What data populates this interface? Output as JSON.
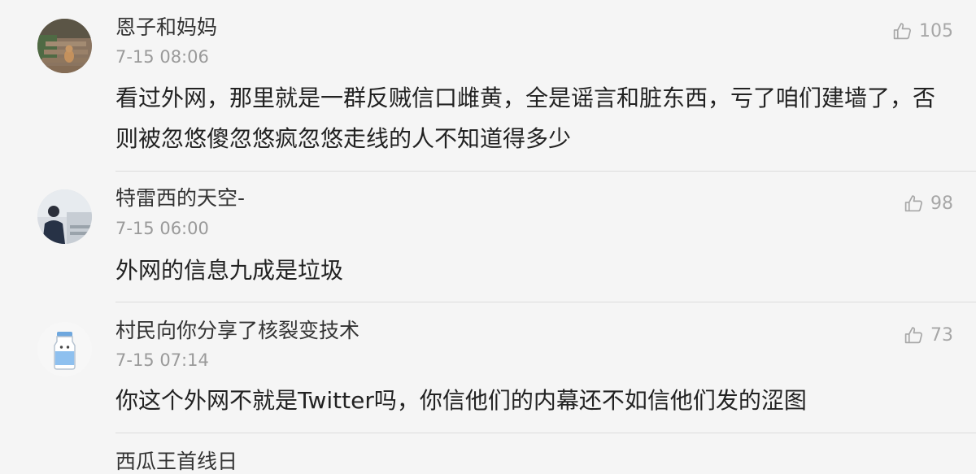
{
  "comments": [
    {
      "username": "恩子和妈妈",
      "timestamp": "7-15 08:06",
      "likes": "105",
      "text": "看过外网，那里就是一群反贼信口雌黄，全是谣言和脏东西，亏了咱们建墙了，否则被忽悠傻忽悠疯忽悠走线的人不知道得多少",
      "avatar_icon": "avatar-photo-cat-on-stairs"
    },
    {
      "username": "特雷西的天空-",
      "timestamp": "7-15 06:00",
      "likes": "98",
      "text": "外网的信息九成是垃圾",
      "avatar_icon": "avatar-photo-person-by-window"
    },
    {
      "username": "村民向你分享了核裂变技术",
      "timestamp": "7-15 07:14",
      "likes": "73",
      "text": "你这个外网不就是Twitter吗，你信他们的内幕还不如信他们发的涩图",
      "avatar_icon": "avatar-cartoon-milk-bottle"
    }
  ],
  "partial_comment": {
    "username_fragment": "西瓜王首线日"
  },
  "like_icon": "thumbs-up-icon",
  "colors": {
    "background": "#f5f5f5",
    "username": "#333333",
    "timestamp": "#9a9a9a",
    "body": "#222222",
    "like": "#a7a7a7",
    "divider": "#dcdcdc"
  }
}
